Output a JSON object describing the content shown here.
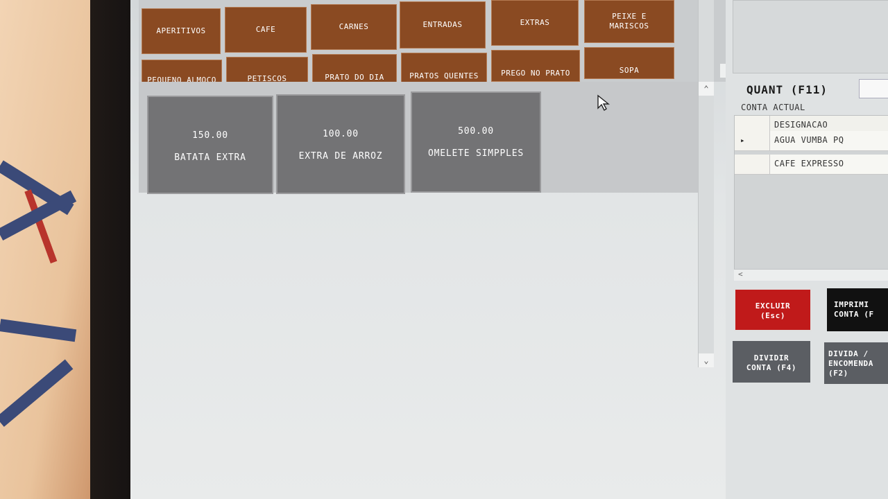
{
  "categories": [
    "APERITIVOS",
    "CAFE",
    "CARNES",
    "ENTRADAS",
    "EXTRAS",
    "PEIXE E\nMARISCOS",
    "PEQUENO ALMOCO",
    "PETISCOS",
    "PRATO DO DIA",
    "PRATOS QUENTES",
    "PREGO NO PRATO",
    "SOPA"
  ],
  "products": [
    {
      "price": "150.00",
      "name": "BATATA EXTRA"
    },
    {
      "price": "100.00",
      "name": "EXTRA DE ARROZ"
    },
    {
      "price": "500.00",
      "name": "OMELETE SIMPPLES"
    }
  ],
  "quant": {
    "label": "QUANT (F11)",
    "value": ""
  },
  "conta": {
    "label": "CONTA ACTUAL",
    "header": "DESIGNACAO",
    "selected_marker": "▸",
    "items": [
      "AGUA VUMBA PQ",
      "CAFE EXPRESSO"
    ]
  },
  "actions": {
    "excluir": "EXCLUIR\n(Esc)",
    "imprimir": "IMPRIMI\nCONTA (F",
    "dividir": "DIVIDIR\nCONTA (F4)",
    "divida": "DIVIDA /\nENCOMENDA\n(F2)"
  },
  "colors": {
    "category": "#8a4a22",
    "product": "#737375",
    "excluir": "#c01a1a",
    "imprimir": "#111111",
    "dividir": "#5b5e63"
  }
}
